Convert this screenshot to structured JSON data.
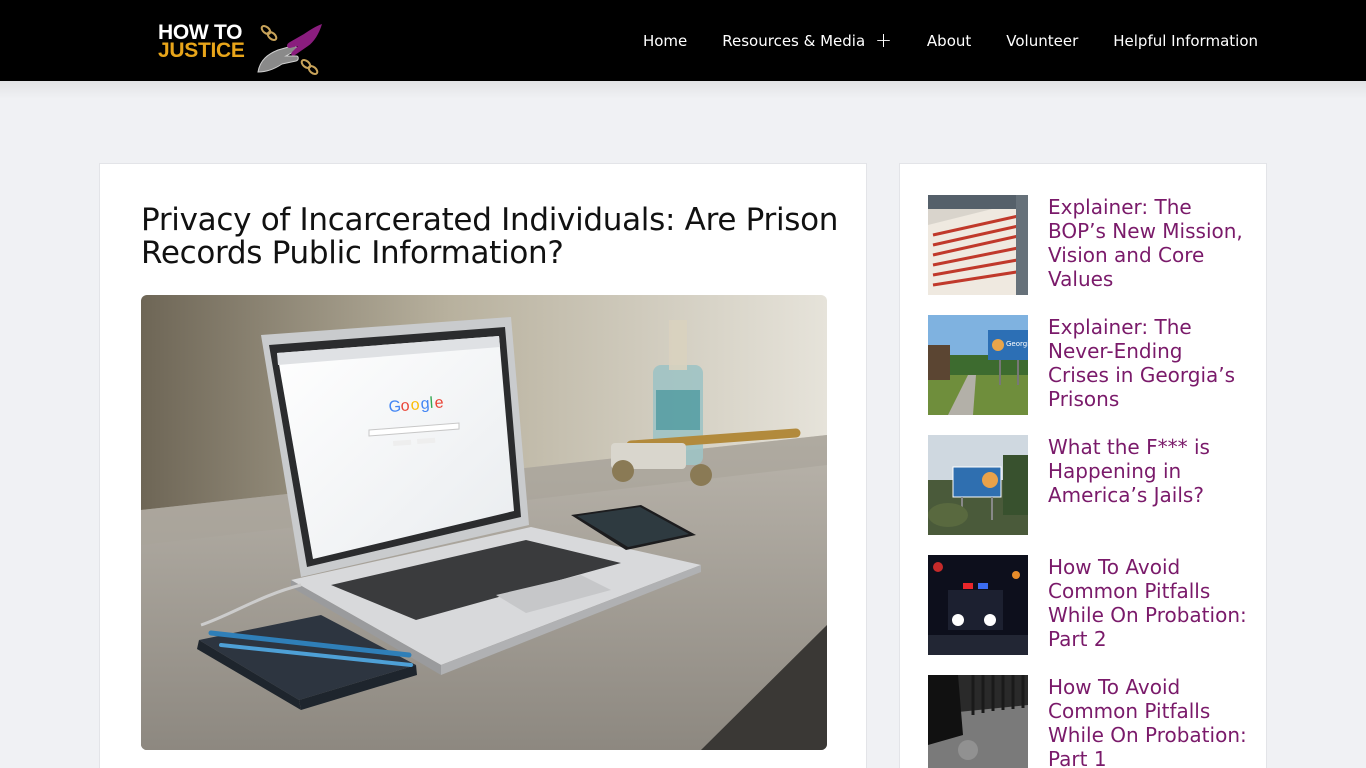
{
  "header": {
    "logo": {
      "line1": "HOW TO",
      "line2": "JUSTICE"
    },
    "nav": [
      {
        "label": "Home"
      },
      {
        "label": "Resources & Media",
        "icon": "plus-icon"
      },
      {
        "label": "About"
      },
      {
        "label": "Volunteer"
      },
      {
        "label": "Helpful Information"
      }
    ]
  },
  "post": {
    "title": "Privacy of Incarcerated Individuals: Are Prison Records Public Information?"
  },
  "sidebar": {
    "items": [
      {
        "title": "Explainer: The BOP’s New Mission, Vision and Core Values"
      },
      {
        "title": "Explainer: The Never-Ending Crises in Georgia’s Prisons"
      },
      {
        "title": "What the F*** is Happening in America’s Jails?"
      },
      {
        "title": "How To Avoid Common Pitfalls While On Probation: Part 2"
      },
      {
        "title": "How To Avoid Common Pitfalls While On Probation: Part 1"
      }
    ]
  },
  "colors": {
    "header_bg": "#000000",
    "logo_accent": "#e8a51a",
    "link": "#7a1a6a",
    "page_bg": "#f0f1f4"
  }
}
